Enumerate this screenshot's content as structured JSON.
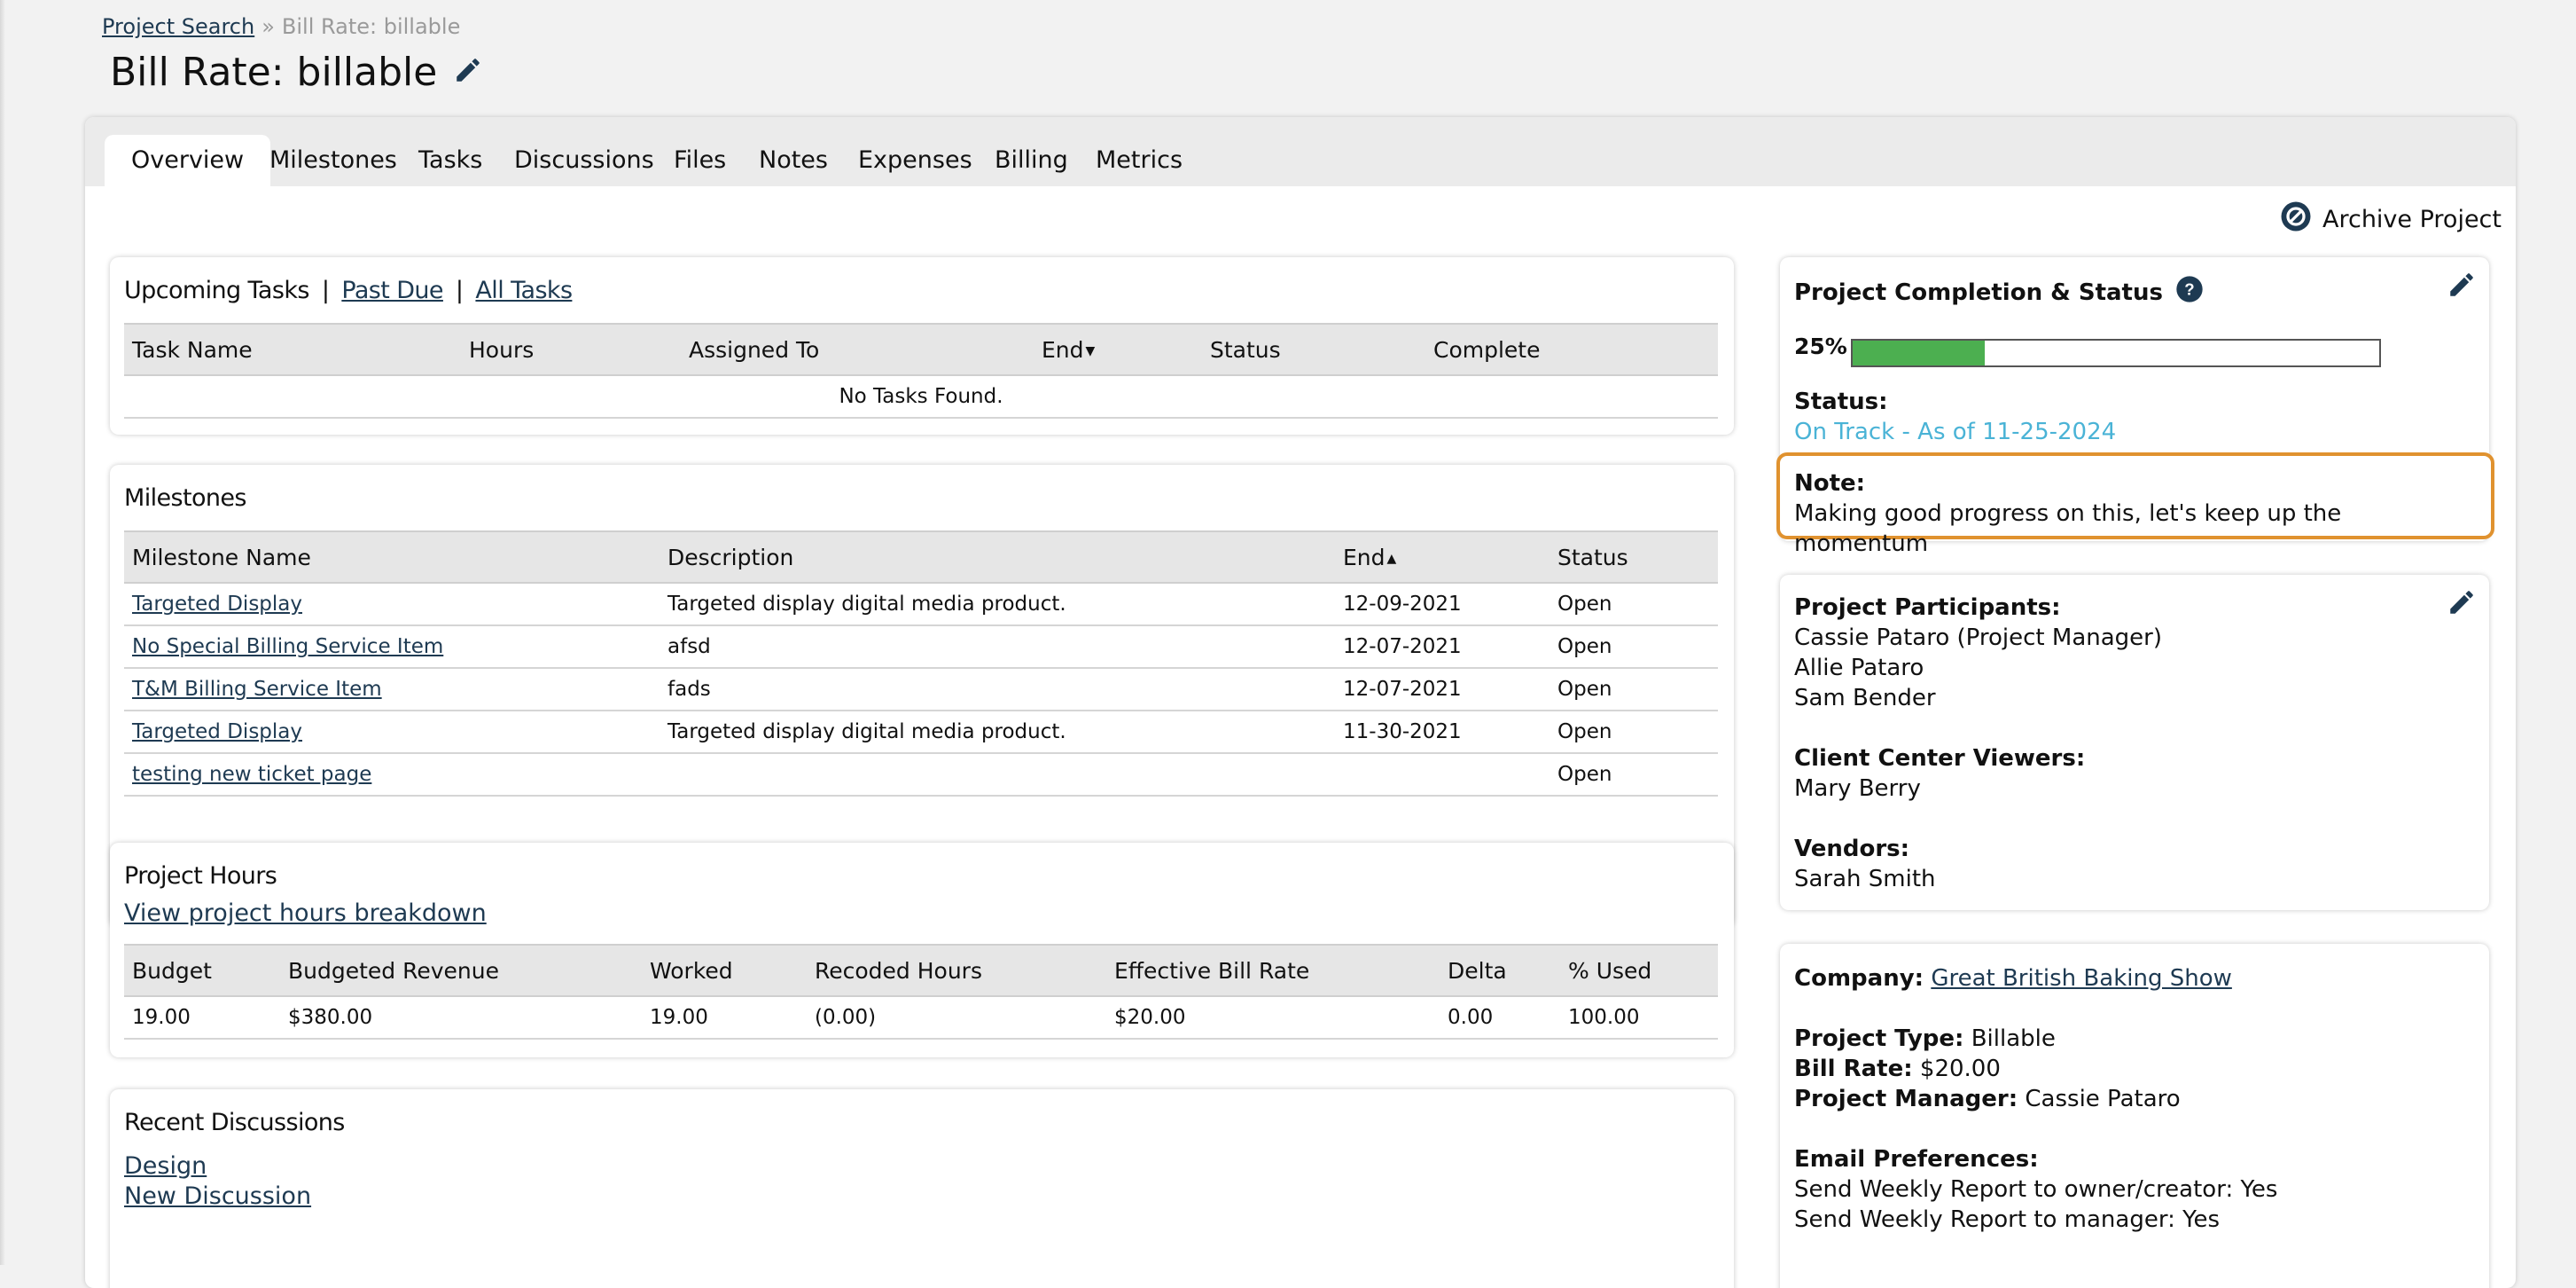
{
  "breadcrumb": {
    "root": "Project Search",
    "separator": "»",
    "current": "Bill Rate: billable"
  },
  "page_title": "Bill Rate: billable",
  "tabs": [
    "Overview",
    "Milestones",
    "Tasks",
    "Discussions",
    "Files",
    "Notes",
    "Expenses",
    "Billing",
    "Metrics"
  ],
  "archive_label": "Archive Project",
  "tasks": {
    "upcoming_label": "Upcoming Tasks",
    "divider": "|",
    "past_due_label": "Past Due",
    "all_tasks_label": "All Tasks",
    "columns": [
      "Task Name",
      "Hours",
      "Assigned To",
      "End",
      "Status",
      "Complete"
    ],
    "empty_text": "No Tasks Found."
  },
  "milestones": {
    "title": "Milestones",
    "columns": [
      "Milestone Name",
      "Description",
      "End",
      "Status"
    ],
    "rows": [
      {
        "name": "Targeted Display",
        "description": "Targeted display digital media product.",
        "end": "12-09-2021",
        "status": "Open"
      },
      {
        "name": "No Special Billing Service Item",
        "description": "afsd",
        "end": "12-07-2021",
        "status": "Open"
      },
      {
        "name": "T&M Billing Service Item",
        "description": "fads",
        "end": "12-07-2021",
        "status": "Open"
      },
      {
        "name": "Targeted Display",
        "description": "Targeted display digital media product.",
        "end": "11-30-2021",
        "status": "Open"
      },
      {
        "name": "testing new ticket page",
        "description": "",
        "end": "",
        "status": "Open"
      }
    ]
  },
  "hours": {
    "title": "Project Hours",
    "breakdown_link": "View project hours breakdown",
    "columns": [
      "Budget",
      "Budgeted Revenue",
      "Worked",
      "Recoded Hours",
      "Effective Bill Rate",
      "Delta",
      "% Used"
    ],
    "row": [
      "19.00",
      "$380.00",
      "19.00",
      "(0.00)",
      "$20.00",
      "0.00",
      "100.00"
    ]
  },
  "discussions": {
    "title": "Recent Discussions",
    "items": [
      "Design",
      "New Discussion"
    ]
  },
  "status_panel": {
    "title": "Project Completion & Status",
    "percent_label": "25%",
    "percent_value": 25,
    "status_label": "Status:",
    "status_value": "On Track - As of 11-25-2024",
    "note_label": "Note:",
    "note_value": "Making good progress on this, let's keep up the momentum"
  },
  "participants": {
    "participants_label": "Project Participants:",
    "participants": [
      "Cassie Pataro (Project Manager)",
      "Allie Pataro",
      "Sam Bender"
    ],
    "viewers_label": "Client Center Viewers:",
    "viewers": [
      "Mary Berry"
    ],
    "vendors_label": "Vendors:",
    "vendors": [
      "Sarah Smith"
    ]
  },
  "details": {
    "company_label": "Company:",
    "company_value": "Great British Baking Show",
    "type_label": "Project Type:",
    "type_value": "Billable",
    "rate_label": "Bill Rate:",
    "rate_value": "$20.00",
    "manager_label": "Project Manager:",
    "manager_value": "Cassie Pataro",
    "email_label": "Email Preferences:",
    "email_owner": "Send Weekly Report to owner/creator: Yes",
    "email_manager": "Send Weekly Report to manager: Yes"
  },
  "colors": {
    "accent_link": "#1e3a52",
    "status_ok": "#4ab3d6",
    "progress": "#4caf50",
    "note_border": "#e0922f"
  }
}
